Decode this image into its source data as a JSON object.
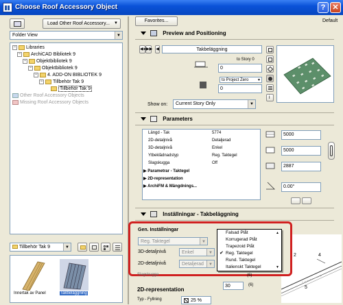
{
  "window": {
    "title": "Choose Roof Accessory Object"
  },
  "left": {
    "load_button": "Load Other Roof Accessory...",
    "view_select": "Folder View",
    "tree": [
      {
        "label": "Libraries",
        "type": "folder"
      },
      {
        "label": "ArchiCAD Bibliotek 9",
        "type": "folder"
      },
      {
        "label": "Objektbibliotek 9",
        "type": "folder"
      },
      {
        "label": "Objektbibliotek 9",
        "type": "folder"
      },
      {
        "label": "4. ADD-ON BIBLIOTEK 9",
        "type": "folder"
      },
      {
        "label": "Tillbehör Tak 9",
        "type": "folder"
      },
      {
        "label": "Tillbehör Tak 9",
        "type": "folder"
      },
      {
        "label": "Other Roof Accessory Objects",
        "type": "other"
      },
      {
        "label": "Missing Roof Accessory Objects",
        "type": "missing"
      }
    ],
    "folder_select": "Tillbehör Tak 9",
    "thumbs": [
      {
        "label": "Innertak av Panel"
      },
      {
        "label": "Takbeläggning"
      }
    ]
  },
  "right": {
    "favorites_button": "Favorites...",
    "default_label": "Default",
    "preview": {
      "title": "Preview and Positioning",
      "object_name": "Takbeläggning",
      "to_story": "to Story 0",
      "to_story_value": "0",
      "to_project_zero": "to Project Zero",
      "to_project_value": "0",
      "show_on_label": "Show on:",
      "show_on_value": "Current Story Only"
    },
    "parameters": {
      "title": "Parameters",
      "rows": [
        {
          "name": "Längd - Tak",
          "value": "5774"
        },
        {
          "name": "2D-detaljnivå",
          "value": "Detaljerad"
        },
        {
          "name": "3D-detaljnivå",
          "value": "Enkel"
        },
        {
          "name": "Ytbeklädnadstyp",
          "value": "Reg. Taktegel"
        },
        {
          "name": "Slagskugga",
          "value": "Off"
        }
      ],
      "groups": [
        "Parametrar - Taktegel",
        "2D-representation",
        "ArchiFM & Mängdnings..."
      ],
      "side_values": [
        "5000",
        "5000",
        "2887",
        "0.00°"
      ]
    },
    "settings": {
      "title": "Inställningar - Takbeläggning",
      "gen_title": "Gen. Inställningar",
      "type_value": "Reg. Taktegel",
      "row3d_label": "3D-detaljnivå",
      "row3d_value": "Enkel",
      "row2d_label": "2D-detaljnivå",
      "row2d_value": "Detaljerad",
      "slagskugga_label": "Slagskugga",
      "num_value": "30",
      "annot_6": "(6)",
      "annot_2": "2",
      "annot_5": "5",
      "annot_4": "4",
      "two_d_title": "2D-representation",
      "fill_label": "Typ - Fyllning",
      "fill_value": "25 %"
    },
    "dropdown": [
      {
        "label": "Falsad Plåt",
        "checked": false
      },
      {
        "label": "Korrugerad Plåt",
        "checked": false
      },
      {
        "label": "Trapezoid Plåt",
        "checked": false
      },
      {
        "label": "Reg. Taktegel",
        "checked": true
      },
      {
        "label": "Rund. Taktegel",
        "checked": false
      },
      {
        "label": "Italienskt Taktegel",
        "checked": false
      }
    ]
  }
}
